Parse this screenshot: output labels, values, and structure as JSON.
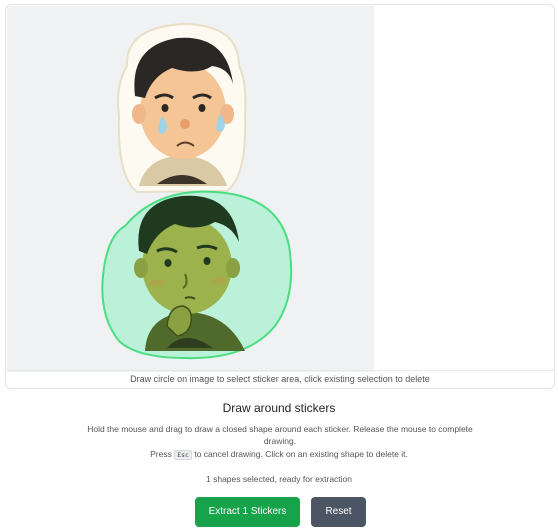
{
  "canvas": {
    "caption": "Draw circle on image to select sticker area, click existing selection to delete",
    "selection_color": "#4ade80"
  },
  "panel": {
    "title": "Draw around stickers",
    "instruction_line1": "Hold the mouse and drag to draw a closed shape around each sticker. Release the mouse to complete drawing.",
    "instruction_press": "Press",
    "esc_key": "Esc",
    "instruction_line2": "to cancel drawing. Click on an existing shape to delete it.",
    "status": "1 shapes selected, ready for extraction"
  },
  "buttons": {
    "extract_label": "Extract 1 Stickers",
    "reset_label": "Reset",
    "extract_color": "#16a34a",
    "reset_color": "#4b5563"
  }
}
